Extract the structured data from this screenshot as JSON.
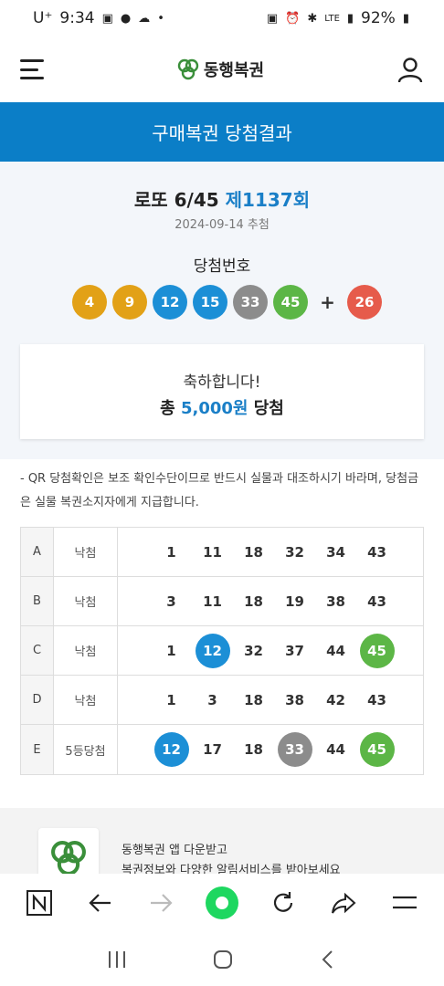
{
  "status_bar": {
    "carrier": "U⁺",
    "time": "9:34",
    "network": "LTE",
    "battery": "92%"
  },
  "nav": {
    "logo_text": "동행복권"
  },
  "banner": {
    "title": "구매복권 당첨결과"
  },
  "draw": {
    "game": "로또 6/45",
    "round": "제1137회",
    "date": "2024-09-14 추첨",
    "winning_label": "당첨번호",
    "numbers": [
      "4",
      "9",
      "12",
      "15",
      "33",
      "45"
    ],
    "plus": "+",
    "bonus": "26"
  },
  "congrats": {
    "line1": "축하합니다!",
    "prefix": "총",
    "amount": "5,000원",
    "suffix": "당첨"
  },
  "notice": {
    "text": "- QR 당첨확인은 보조 확인수단이므로 반드시 실물과 대조하시기 바라며, 당첨금은 실물 복권소지자에게 지급합니다."
  },
  "ticket": {
    "rows": [
      {
        "id": "A",
        "result": "낙첨",
        "nums": [
          "1",
          "11",
          "18",
          "32",
          "34",
          "43"
        ]
      },
      {
        "id": "B",
        "result": "낙첨",
        "nums": [
          "3",
          "11",
          "18",
          "19",
          "38",
          "43"
        ]
      },
      {
        "id": "C",
        "result": "낙첨",
        "nums": [
          "1",
          "12",
          "32",
          "37",
          "44",
          "45"
        ]
      },
      {
        "id": "D",
        "result": "낙첨",
        "nums": [
          "1",
          "3",
          "18",
          "38",
          "42",
          "43"
        ]
      },
      {
        "id": "E",
        "result": "5등당첨",
        "nums": [
          "12",
          "17",
          "18",
          "33",
          "44",
          "45"
        ]
      }
    ]
  },
  "app_promo": {
    "line1": "동행복권 앱 다운받고",
    "line2": "복권정보와 다양한 알림서비스를 받아보세요"
  },
  "colors": {
    "brand_blue": "#0b7ec7",
    "ball_yellow": "#e2a117",
    "ball_blue": "#1c8fd6",
    "ball_gray": "#8c8c8c",
    "ball_green": "#5cb646",
    "ball_red": "#e65b4b"
  }
}
